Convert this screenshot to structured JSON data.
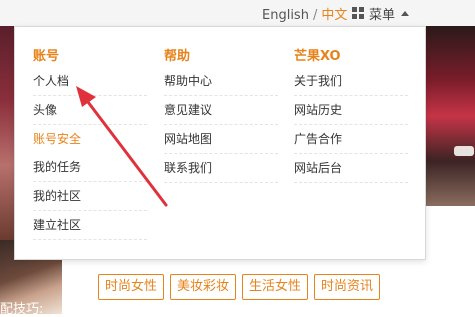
{
  "topbar": {
    "lang_english": "English",
    "lang_separator": "/",
    "lang_chinese": "中文",
    "menu_label": "菜单"
  },
  "dropdown": {
    "columns": [
      {
        "title": "账号",
        "items": [
          "个人档",
          "头像",
          "账号安全",
          "我的任务",
          "我的社区",
          "建立社区"
        ]
      },
      {
        "title": "帮助",
        "items": [
          "帮助中心",
          "意见建议",
          "网站地图",
          "联系我们"
        ]
      },
      {
        "title": "芒果XO",
        "items": [
          "关于我们",
          "网站历史",
          "广告合作",
          "网站后台"
        ]
      }
    ]
  },
  "tags": [
    "时尚女性",
    "美妆彩妆",
    "生活女性",
    "时尚资讯"
  ],
  "left_caption": "配技巧:",
  "colors": {
    "accent": "#e8831b",
    "annotation_arrow": "#e0323c"
  },
  "icons": {
    "menu": "grid-icon",
    "caret": "caret-up-icon"
  }
}
